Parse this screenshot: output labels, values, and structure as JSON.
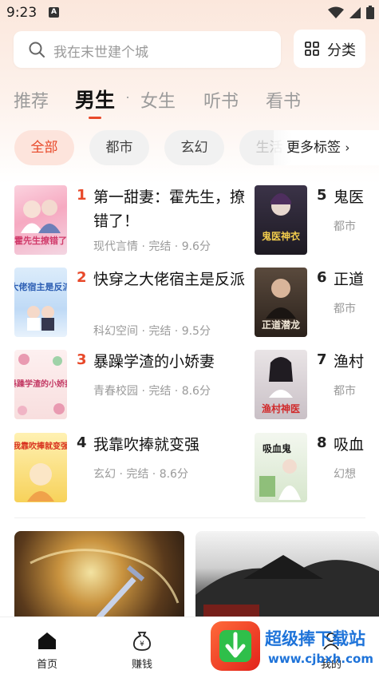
{
  "status_bar": {
    "time": "9:23",
    "notification_letter": "A"
  },
  "search": {
    "placeholder": "我在末世建个城"
  },
  "category_button": {
    "label": "分类"
  },
  "tabs": [
    {
      "label": "推荐",
      "active": false
    },
    {
      "label": "男生",
      "active": true
    },
    {
      "label": "女生",
      "active": false
    },
    {
      "label": "听书",
      "active": false
    },
    {
      "label": "看书",
      "active": false
    }
  ],
  "chips": [
    {
      "label": "全部",
      "active": true
    },
    {
      "label": "都市",
      "active": false
    },
    {
      "label": "玄幻",
      "active": false
    },
    {
      "label": "生活",
      "active": false
    }
  ],
  "more_tags": "更多标签",
  "ranking_left": [
    {
      "rank": "1",
      "title": "第一甜妻：霍先生，撩错了！",
      "meta": "现代言情 · 完结 · 9.6分",
      "cover_text": "霍先生撩错了"
    },
    {
      "rank": "2",
      "title": "快穿之大佬宿主是反派",
      "meta": "科幻空间 · 完结 · 9.5分",
      "cover_text": "大佬宿主是反派"
    },
    {
      "rank": "3",
      "title": "暴躁学渣的小娇妻",
      "meta": "青春校园 · 完结 · 8.6分",
      "cover_text": "暴躁学渣的小娇妻"
    },
    {
      "rank": "4",
      "title": "我靠吹捧就变强",
      "meta": "玄幻 · 完结 · 8.6分",
      "cover_text": "我靠吹捧就变强"
    }
  ],
  "ranking_right": [
    {
      "rank": "5",
      "title": "鬼医",
      "meta": "都市",
      "cover_text": "鬼医神衣"
    },
    {
      "rank": "6",
      "title": "正道",
      "meta": "都市",
      "cover_text": "正道潜龙"
    },
    {
      "rank": "7",
      "title": "渔村",
      "meta": "都市",
      "cover_text": "渔村神医"
    },
    {
      "rank": "8",
      "title": "吸血",
      "meta": "幻想",
      "cover_text": "吸血鬼"
    }
  ],
  "bottom_nav": [
    {
      "label": "首页",
      "icon": "home-icon"
    },
    {
      "label": "赚钱",
      "icon": "money-bag-icon"
    },
    {
      "label": "我的",
      "icon": "profile-icon"
    }
  ],
  "watermark": {
    "text": "超级捧下载站",
    "url": "www.cjbxh.com"
  },
  "colors": {
    "accent": "#e8492a",
    "rank_top": "#e8492a",
    "rank_other": "#222222"
  }
}
